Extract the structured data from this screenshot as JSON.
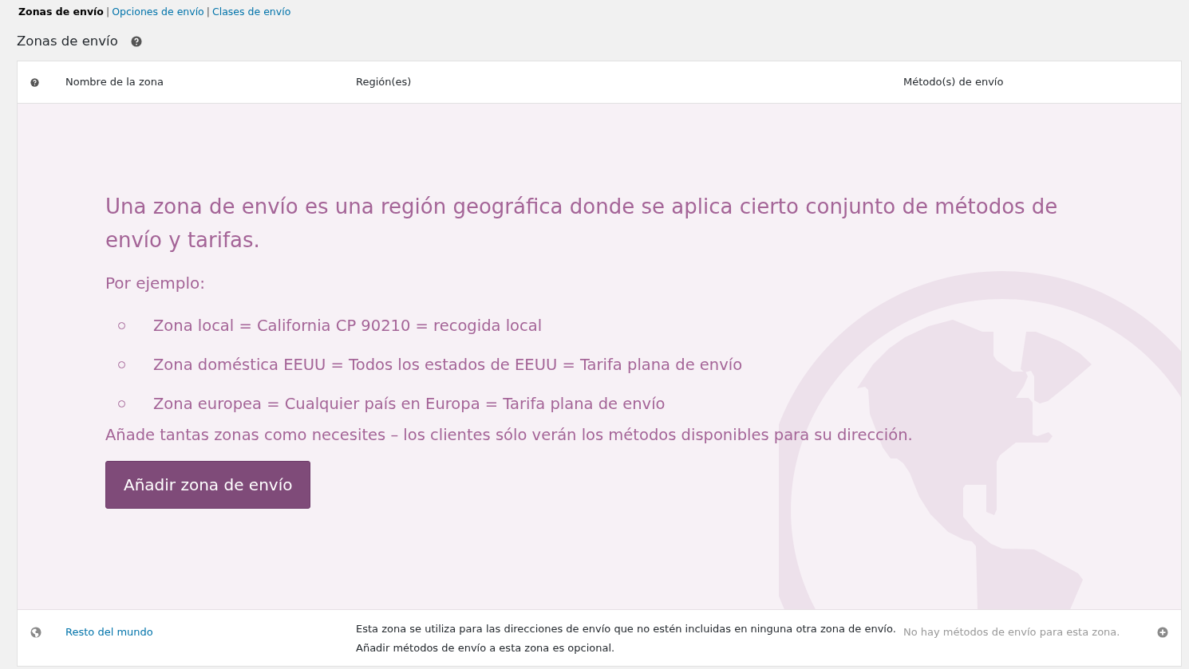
{
  "subnav": [
    {
      "label": "Zonas de envío",
      "selected": true
    },
    {
      "prefix": "|",
      "label": "Opciones de envío",
      "selected": false
    },
    {
      "prefix": "|",
      "label": "Clases de envío",
      "selected": false
    }
  ],
  "heading": "Zonas de envío",
  "table": {
    "columns": [
      "Nombre de la zona",
      "Región(es)",
      "Método(s) de envío"
    ],
    "blank_state": {
      "headline": "Una zona de envío es una región geográfica donde se aplica cierto conjunto de métodos de envío y tarifas.",
      "intro": "Por ejemplo:",
      "examples": [
        "Zona local = California CP 90210 = recogida local",
        "Zona doméstica EEUU = Todos los estados de EEUU = Tarifa plana de envío",
        "Zona europea = Cualquier país en Europa = Tarifa plana de envío"
      ],
      "note": "Añade tantas zonas como necesites – los clientes sólo verán los métodos disponibles para su dirección.",
      "button": "Añadir zona de envío"
    },
    "rows": [
      {
        "name": "Resto del mundo",
        "description": [
          "Esta zona se utiliza para las direcciones de envío que no estén incluidas en ninguna otra zona de envío.",
          "Añadir métodos de envío a esta zona es opcional."
        ],
        "methods": "No hay métodos de envío para esta zona."
      }
    ]
  }
}
